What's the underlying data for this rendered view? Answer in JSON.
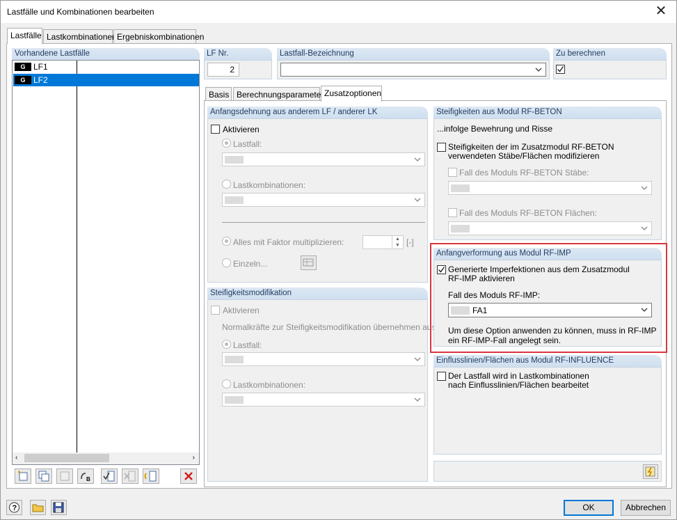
{
  "window": {
    "title": "Lastfälle und Kombinationen bearbeiten"
  },
  "top_tabs": [
    "Lastfälle",
    "Lastkombinationen",
    "Ergebniskombinationen"
  ],
  "left": {
    "header": "Vorhandene Lastfälle",
    "items": [
      {
        "badge": "G",
        "label": "LF1",
        "selected": false
      },
      {
        "badge": "G",
        "label": "LF2",
        "selected": true
      }
    ]
  },
  "lf_nr": {
    "header": "LF Nr.",
    "value": "2"
  },
  "bezeichnung": {
    "header": "Lastfall-Bezeichnung",
    "value": ""
  },
  "zu_berechnen": {
    "header": "Zu berechnen",
    "checked": true
  },
  "sub_tabs": [
    "Basis",
    "Berechnungsparameter",
    "Zusatzoptionen"
  ],
  "anfangsdehnung": {
    "header": "Anfangsdehnung aus anderem LF / anderer LK",
    "activate": "Aktivieren",
    "lastfall": "Lastfall:",
    "lastkombinationen": "Lastkombinationen:",
    "faktor": "Alles mit Faktor multiplizieren:",
    "faktor_unit": "[-]",
    "einzeln": "Einzeln..."
  },
  "steifigkeitsmod": {
    "header": "Steifigkeitsmodifikation",
    "activate": "Aktivieren",
    "info": "Normalkräfte zur Steifigkeitsmodifikation übernehmen aus:",
    "lastfall": "Lastfall:",
    "lastkombinationen": "Lastkombinationen:"
  },
  "rf_beton": {
    "header": "Steifigkeiten aus Modul RF-BETON",
    "subtitle": "...infolge Bewehrung und Risse",
    "check_line1": "Steifigkeiten der im Zusatzmodul RF-BETON",
    "check_line2": "verwendeten Stäbe/Flächen modifizieren",
    "staebe": "Fall des Moduls RF-BETON Stäbe:",
    "flaechen": "Fall des Moduls RF-BETON Flächen:"
  },
  "rf_imp": {
    "header": "Anfangverformung aus Modul RF-IMP",
    "check_line1": "Generierte Imperfektionen aus dem Zusatzmodul",
    "check_line2": "RF-IMP aktivieren",
    "checked": true,
    "fall_label": "Fall des Moduls RF-IMP:",
    "fall_value": "FA1",
    "note_line1": "Um diese Option anwenden zu können, muss in RF-IMP",
    "note_line2": "ein RF-IMP-Fall angelegt sein."
  },
  "rf_influence": {
    "header": "Einflusslinien/Flächen aus Modul RF-INFLUENCE",
    "check_line1": "Der Lastfall wird in Lastkombinationen",
    "check_line2": "nach Einflusslinien/Flächen bearbeitet"
  },
  "buttons": {
    "ok": "OK",
    "cancel": "Abbrechen"
  },
  "colors": {
    "selection": "#0078d7",
    "group_header_text": "#1f3a5f",
    "highlight": "#d9363e"
  }
}
